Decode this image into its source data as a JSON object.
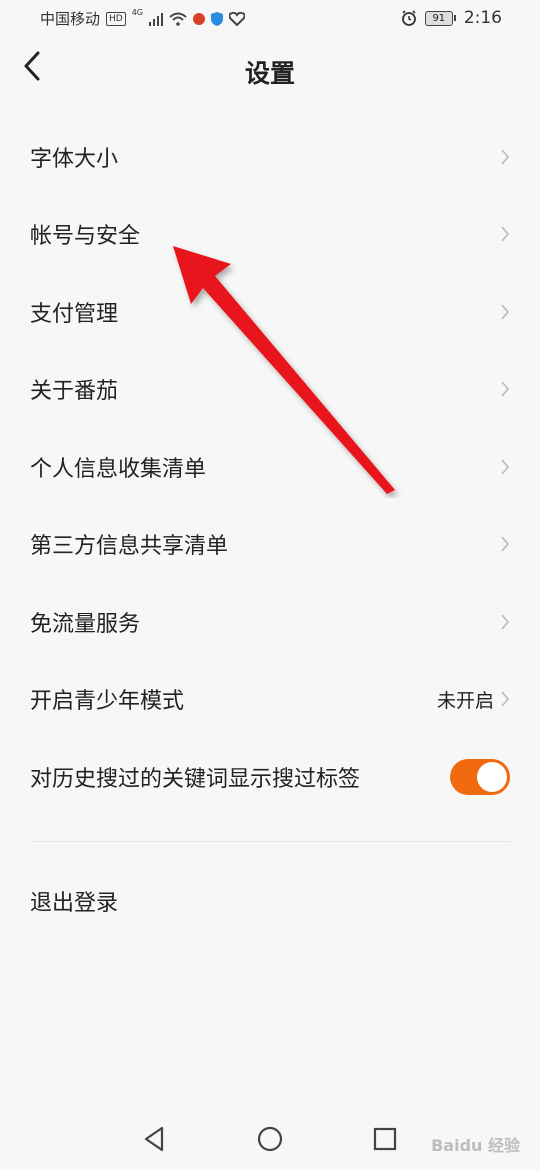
{
  "status_bar": {
    "carrier": "中国移动",
    "hd": "HD",
    "network": "4G",
    "battery": "91",
    "time": "2:16"
  },
  "header": {
    "title": "设置"
  },
  "menu": {
    "items": [
      {
        "label": "字体大小"
      },
      {
        "label": "帐号与安全"
      },
      {
        "label": "支付管理"
      },
      {
        "label": "关于番茄"
      },
      {
        "label": "个人信息收集清单"
      },
      {
        "label": "第三方信息共享清单"
      },
      {
        "label": "免流量服务"
      },
      {
        "label": "开启青少年模式",
        "value": "未开启"
      },
      {
        "label": "对历史搜过的关键词显示搜过标签",
        "toggle": true
      }
    ],
    "toggle_color": "#f26a10"
  },
  "logout_label": "退出登录",
  "annotation_color": "#e8191a",
  "watermark": "Baidu 经验"
}
